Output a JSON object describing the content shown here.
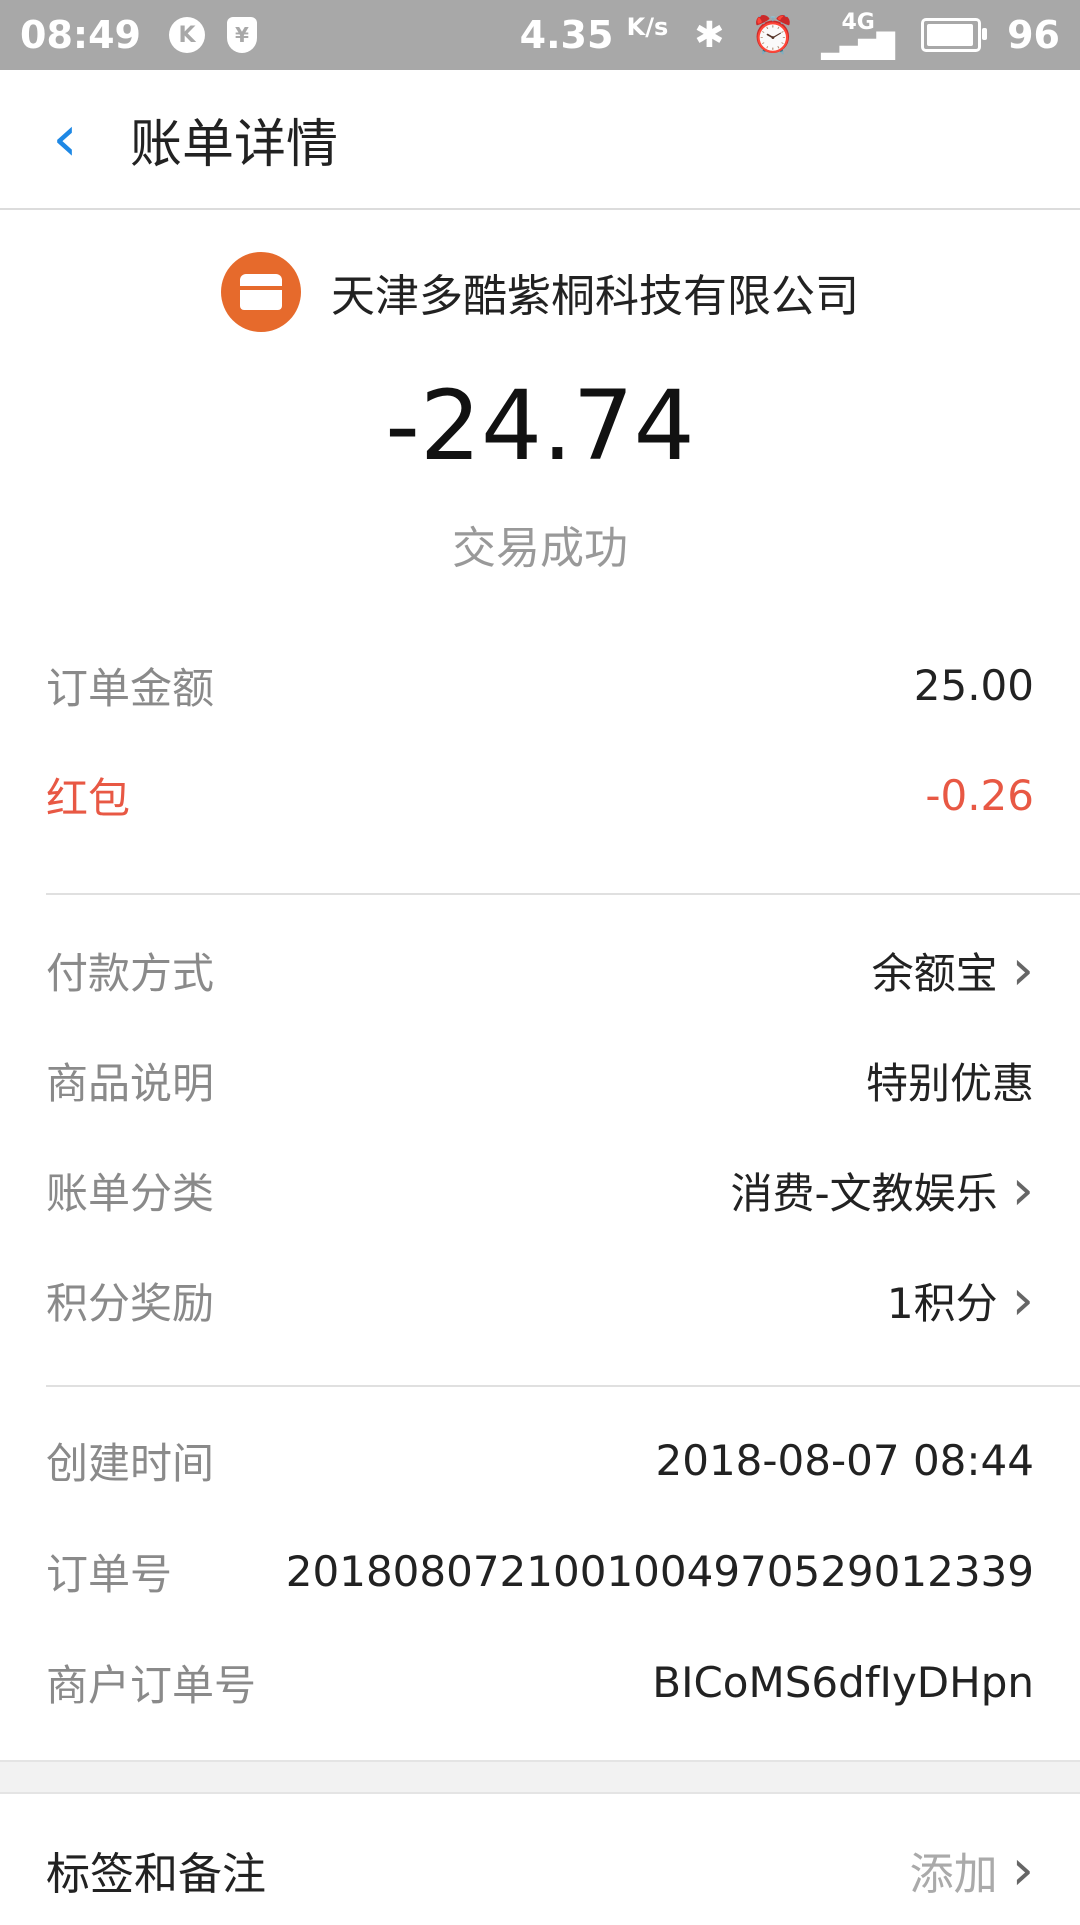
{
  "status_bar": {
    "time": "08:49",
    "app1_icon_letter": "K",
    "app2_icon_letter": "¥",
    "speed": "4.35",
    "speed_unit": "K/s",
    "network": "4G",
    "battery": "96",
    "battery_level": 0.96
  },
  "header": {
    "title": "账单详情"
  },
  "merchant": {
    "name": "天津多酷紫桐科技有限公司",
    "icon_color": "#e66a2c"
  },
  "amount": "-24.74",
  "status": "交易成功",
  "details_group1": [
    {
      "label": "订单金额",
      "value": "25.00"
    },
    {
      "label": "红包",
      "value": "-0.26"
    }
  ],
  "details_group2": [
    {
      "label": "付款方式",
      "value": "余额宝"
    },
    {
      "label": "商品说明",
      "value": "特别优惠"
    },
    {
      "label": "账单分类",
      "value": "消费-文教娱乐"
    },
    {
      "label": "积分奖励",
      "value": "1积分"
    }
  ],
  "details_group3": [
    {
      "label": "创建时间",
      "value": "2018-08-07 08:44"
    },
    {
      "label": "订单号",
      "value": "2018080721001004970529012339"
    },
    {
      "label": "商户订单号",
      "value": "BICoMS6dfIyDHpn"
    }
  ],
  "tags": {
    "label": "标签和备注",
    "action": "添加"
  },
  "colors": {
    "accent_blue": "#1e88e5",
    "red": "#e85844"
  }
}
